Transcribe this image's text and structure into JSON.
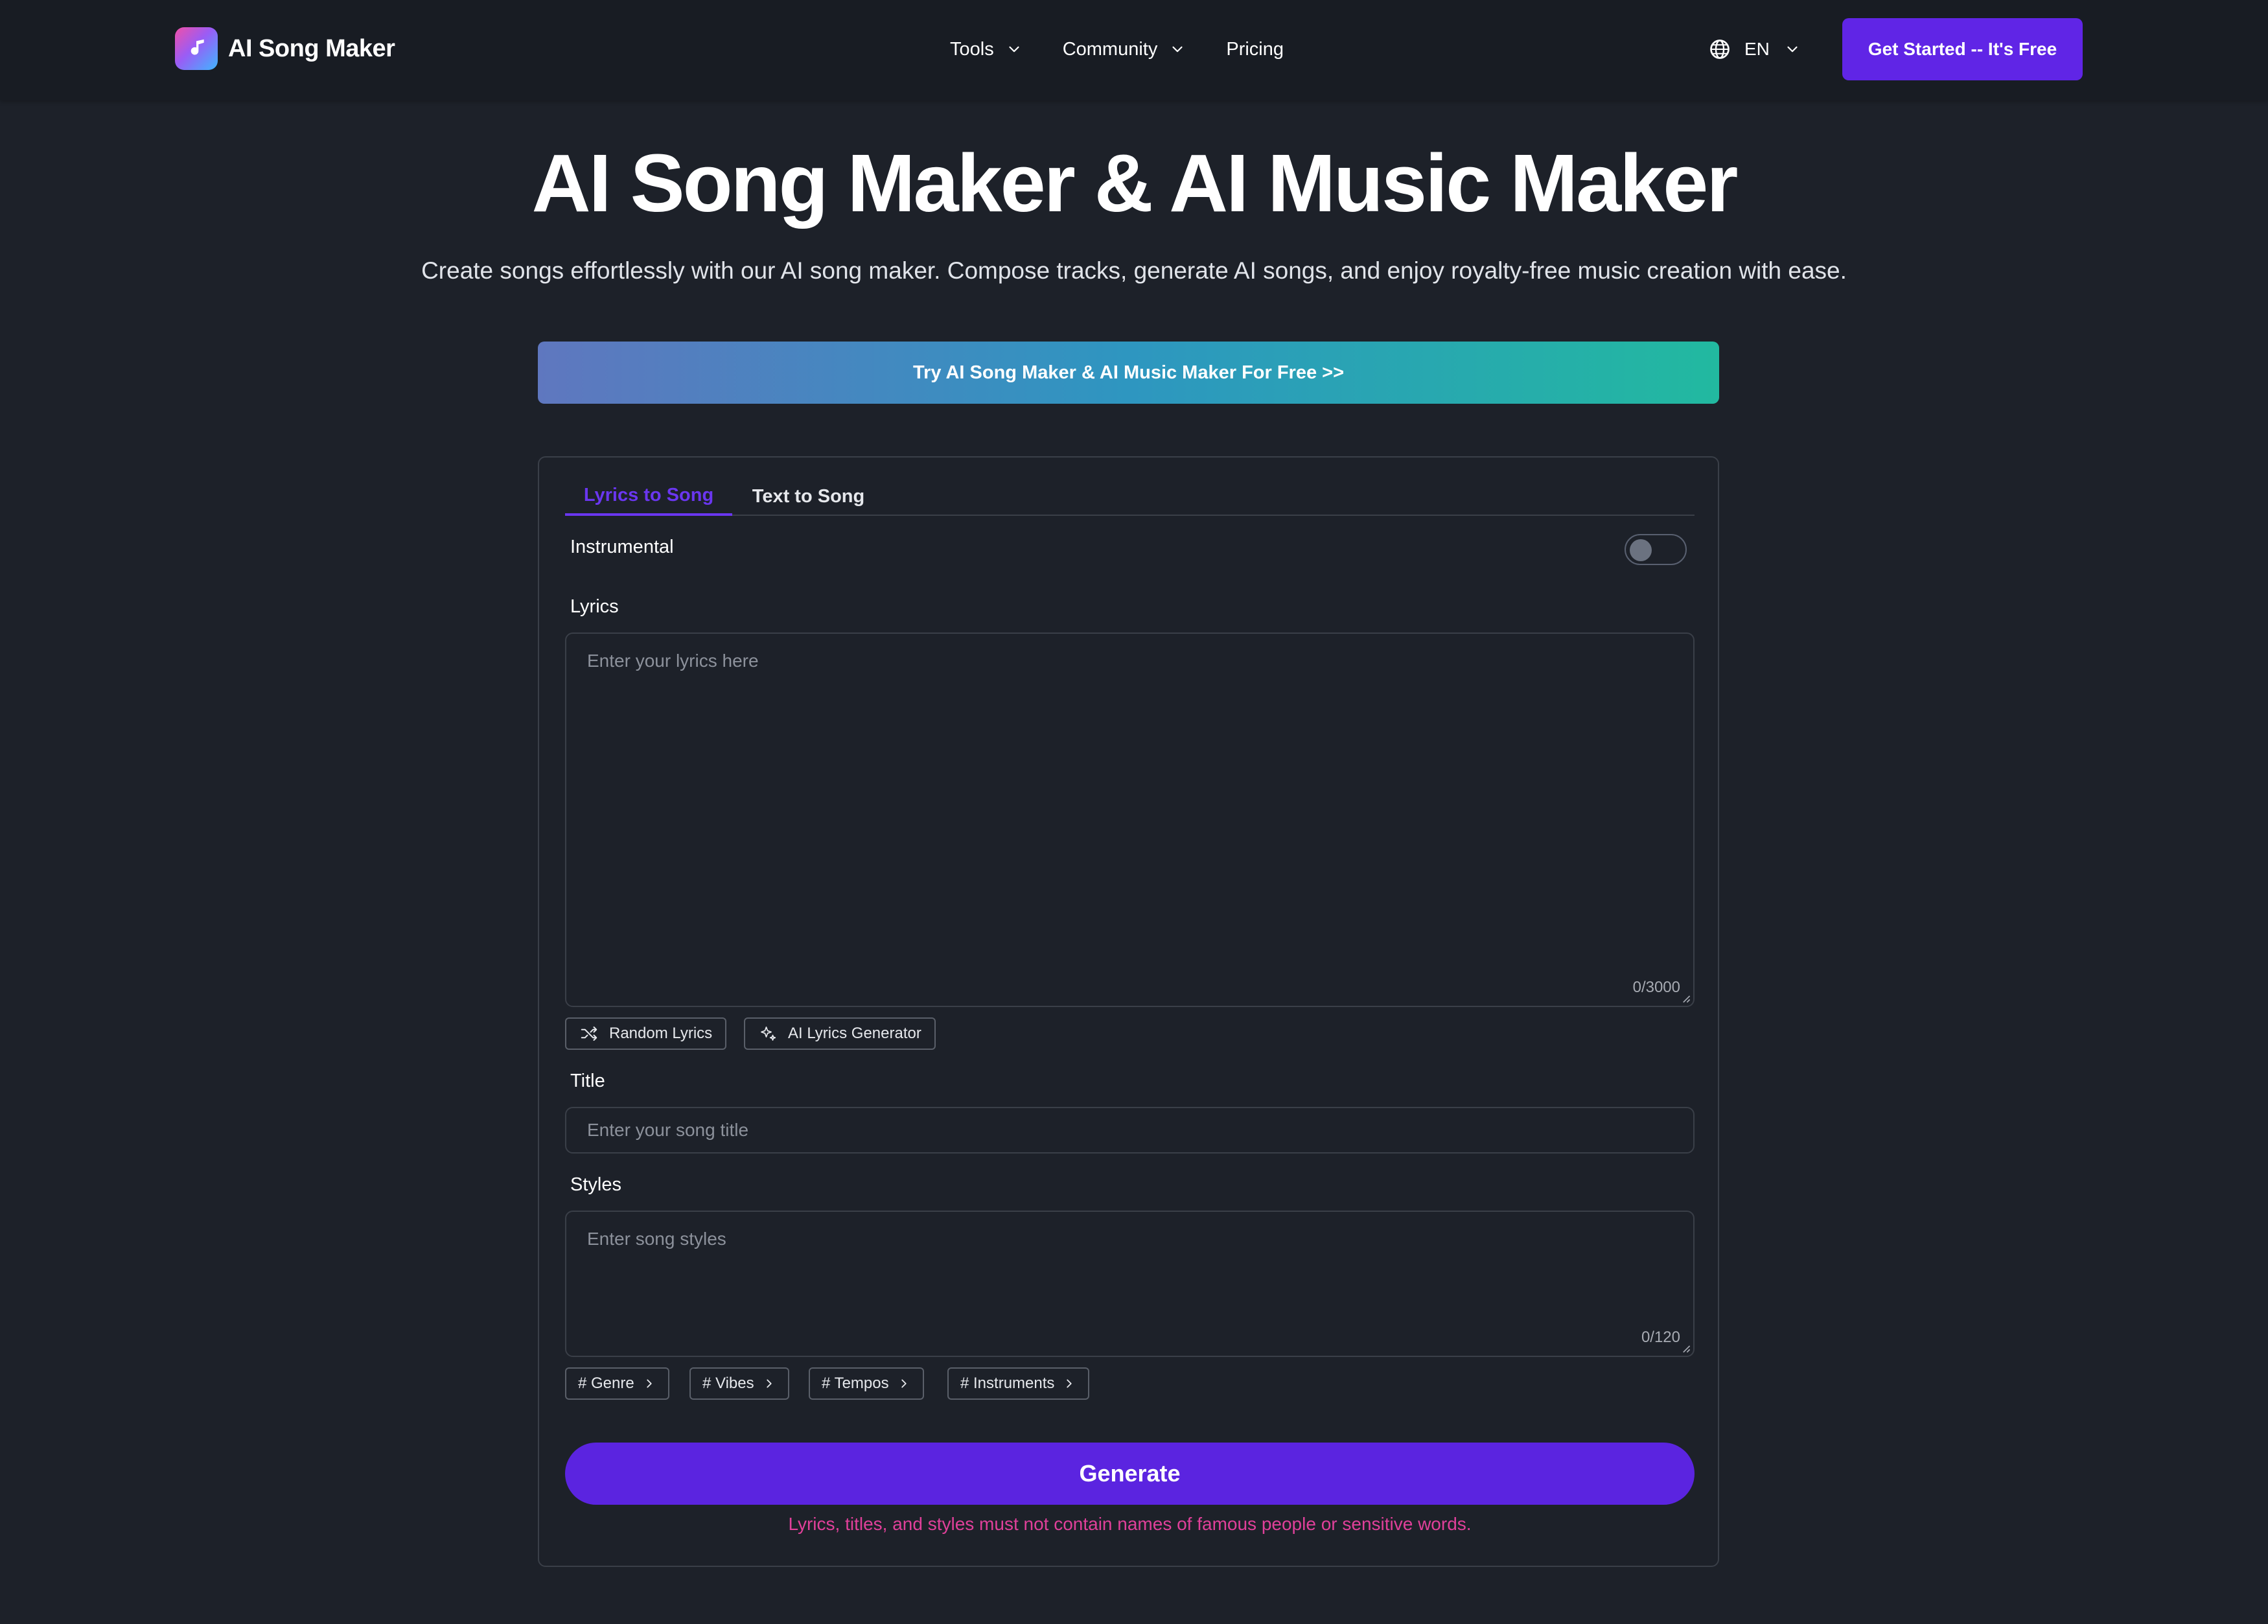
{
  "header": {
    "brand": "AI Song Maker",
    "nav": [
      {
        "label": "Tools",
        "has_dropdown": true
      },
      {
        "label": "Community",
        "has_dropdown": true
      },
      {
        "label": "Pricing",
        "has_dropdown": false
      }
    ],
    "language": "EN",
    "cta_label": "Get Started -- It's Free"
  },
  "hero": {
    "title": "AI Song Maker & AI Music Maker",
    "subtitle": "Create songs effortlessly with our AI song maker. Compose tracks, generate AI songs, and enjoy royalty-free music creation with ease.",
    "banner_label": "Try AI Song Maker & AI Music Maker For Free >>"
  },
  "form": {
    "tabs": [
      {
        "label": "Lyrics to Song",
        "active": true
      },
      {
        "label": "Text to Song",
        "active": false
      }
    ],
    "instrumental_label": "Instrumental",
    "instrumental_on": false,
    "lyrics": {
      "label": "Lyrics",
      "placeholder": "Enter your lyrics here",
      "counter": "0/3000"
    },
    "lyric_actions": [
      {
        "label": "Random Lyrics",
        "icon": "shuffle-icon"
      },
      {
        "label": "AI Lyrics Generator",
        "icon": "sparkle-icon"
      }
    ],
    "title": {
      "label": "Title",
      "placeholder": "Enter your song title"
    },
    "styles": {
      "label": "Styles",
      "placeholder": "Enter song styles",
      "counter": "0/120"
    },
    "style_tags": [
      "# Genre",
      "# Vibes",
      "# Tempos",
      "# Instruments"
    ],
    "generate_label": "Generate",
    "warning": "Lyrics, titles, and styles must not contain names of famous people or sensitive words."
  },
  "colors": {
    "background": "#1d2129",
    "header": "#181c23",
    "accent": "#6025e6",
    "warning": "#e0409a"
  }
}
